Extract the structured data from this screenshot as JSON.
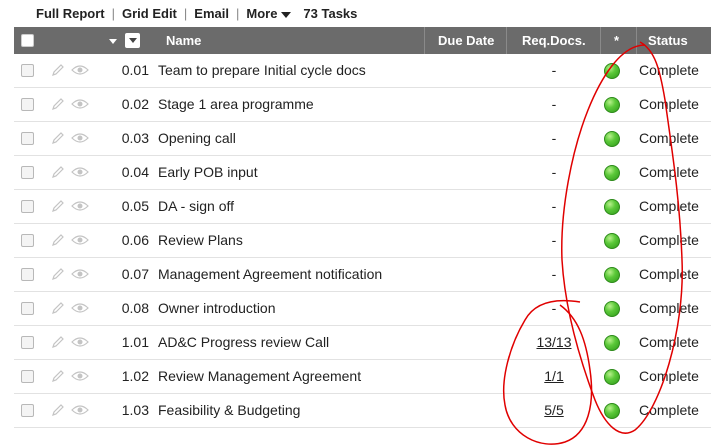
{
  "toolbar": {
    "full_report": "Full Report",
    "grid_edit": "Grid Edit",
    "email": "Email",
    "more": "More",
    "task_count": "73 Tasks"
  },
  "header": {
    "name": "Name",
    "due_date": "Due Date",
    "req_docs": "Req.Docs.",
    "star": "*",
    "status": "Status"
  },
  "colors": {
    "header_bg": "#6b6b6b",
    "status_dot": "#5cc93a",
    "annotation": "#e00000"
  },
  "tasks": [
    {
      "num": "0.01",
      "name": "Team to prepare Initial cycle docs",
      "docs": "-",
      "status": "Complete"
    },
    {
      "num": "0.02",
      "name": "Stage 1 area programme",
      "docs": "-",
      "status": "Complete"
    },
    {
      "num": "0.03",
      "name": "Opening call",
      "docs": "-",
      "status": "Complete"
    },
    {
      "num": "0.04",
      "name": "Early POB input",
      "docs": "-",
      "status": "Complete"
    },
    {
      "num": "0.05",
      "name": "DA - sign off",
      "docs": "-",
      "status": "Complete"
    },
    {
      "num": "0.06",
      "name": "Review Plans",
      "docs": "-",
      "status": "Complete"
    },
    {
      "num": "0.07",
      "name": "Management Agreement notification",
      "docs": "-",
      "status": "Complete"
    },
    {
      "num": "0.08",
      "name": "Owner introduction",
      "docs": "-",
      "status": "Complete"
    },
    {
      "num": "1.01",
      "name": "AD&C Progress review Call",
      "docs": "13/13",
      "status": "Complete"
    },
    {
      "num": "1.02",
      "name": "Review Management Agreement",
      "docs": "1/1",
      "status": "Complete"
    },
    {
      "num": "1.03",
      "name": "Feasibility & Budgeting",
      "docs": "5/5",
      "status": "Complete"
    }
  ]
}
